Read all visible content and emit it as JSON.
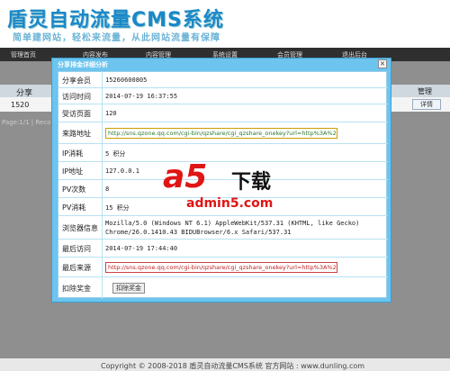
{
  "header": {
    "logo": "盾灵自动流量CMS系统",
    "slogan": "简单建网站，轻松来流量，从此网站流量有保障"
  },
  "nav": {
    "items": [
      "管理首页",
      "内容发布",
      "内容管理",
      "系统设置",
      "会员管理",
      "退出后台"
    ]
  },
  "table": {
    "col_first": "分享",
    "col_manage": "管理",
    "row_member": "1520",
    "detail_btn": "详情",
    "pager": "Page:1/1 | Reco"
  },
  "modal": {
    "title": "分享排金详细分析",
    "close": "×",
    "rows": [
      {
        "label": "分享会员",
        "value": "15260600805"
      },
      {
        "label": "访问时间",
        "value": "2014-07-19 16:37:55"
      },
      {
        "label": "受访页面",
        "value": "120"
      },
      {
        "label": "来路地址",
        "value": "http://sns.qzone.qq.com/cgi-bin/qzshare/cgi_qzshare_onekey?url=http%3A%2F%2F1"
      },
      {
        "label": "IP消耗",
        "value": "5 积分"
      },
      {
        "label": "IP地址",
        "value": "127.0.0.1"
      },
      {
        "label": "PV次数",
        "value": "8"
      },
      {
        "label": "PV消耗",
        "value": "15 积分"
      },
      {
        "label": "浏览器信息",
        "value": "Mozilla/5.0 (Windows NT 6.1) AppleWebKit/537.31 (KHTML, like Gecko)",
        "value2": "Chrome/26.0.1410.43 BIDUBrowser/6.x Safari/537.31"
      },
      {
        "label": "最后访问",
        "value": "2014-07-19 17:44:40"
      },
      {
        "label": "最后来源",
        "value": "http://sns.qzone.qq.com/cgi-bin/qzshare/cgi_qzshare_onekey?url=http%3A%2F%2F1"
      },
      {
        "label": "扣除奖金",
        "value": "扣除奖金"
      }
    ]
  },
  "watermark": {
    "a5": "a5",
    "xz": "下载",
    "url": "admin5.com"
  },
  "footer": {
    "text": "Copyright © 2008-2018 盾灵自动流量CMS系统 官方网站 : www.dunling.com"
  }
}
